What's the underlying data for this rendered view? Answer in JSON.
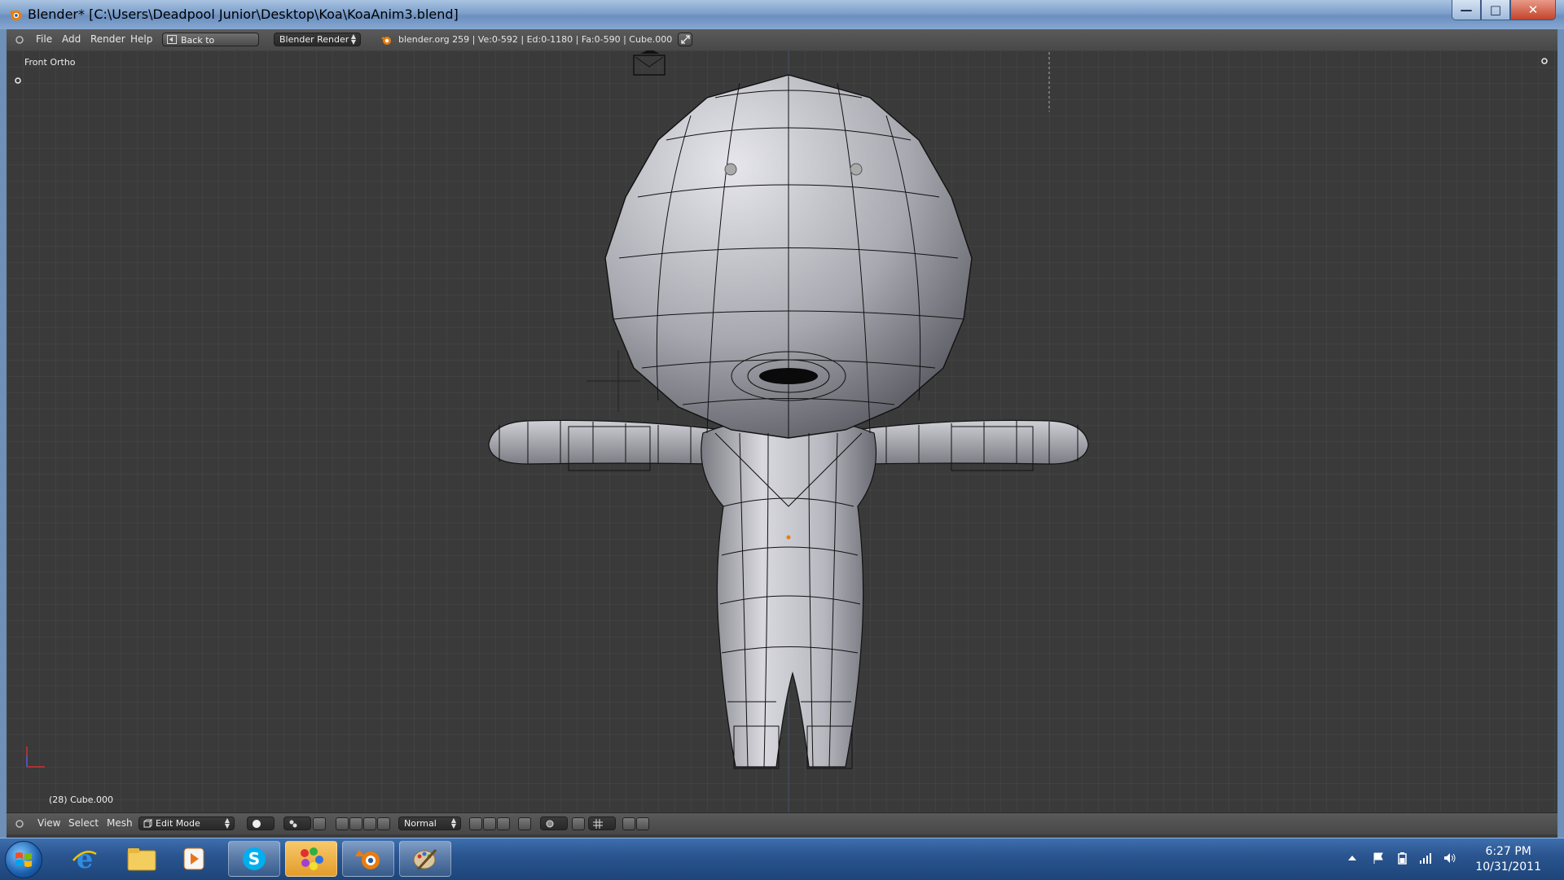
{
  "window": {
    "title": "Blender* [C:\\Users\\Deadpool Junior\\Desktop\\Koa\\KoaAnim3.blend]",
    "minimize": "—",
    "maximize": "□",
    "close": "✕"
  },
  "topbar": {
    "menu": [
      "File",
      "Add",
      "Render",
      "Help"
    ],
    "back_button": "Back to Previous",
    "engine": "Blender Render",
    "stats": "blender.org 259 | Ve:0-592 | Ed:0-1180 | Fa:0-590 | Cube.000"
  },
  "viewport": {
    "view_name": "Front Ortho",
    "object_info": "(28) Cube.000"
  },
  "bottombar": {
    "menu": [
      "View",
      "Select",
      "Mesh"
    ],
    "mode": "Edit Mode",
    "orientation": "Normal"
  },
  "taskbar": {
    "apps": [
      "internet-explorer",
      "file-explorer",
      "media-player",
      "skype",
      "paint-app",
      "blender",
      "paint-brush-app"
    ],
    "time": "6:27 PM",
    "date": "10/31/2011"
  },
  "colors": {
    "accent": "#e87d0d",
    "viewport_bg": "#3a3a3a",
    "header": "#4e4e4e"
  }
}
